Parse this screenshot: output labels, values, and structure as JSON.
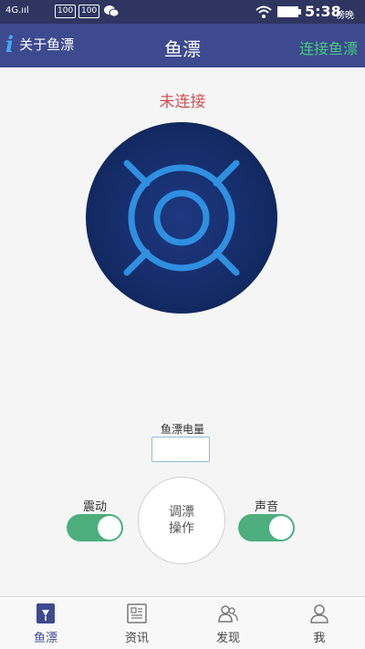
{
  "status_bar": {
    "signal": "4G.ııl",
    "battery_a": "100",
    "battery_b": "100",
    "time": "5:38",
    "period": "傍晚"
  },
  "nav": {
    "about_label": "关于鱼漂",
    "title": "鱼漂",
    "connect_label": "连接鱼漂"
  },
  "main": {
    "connection_status": "未连接",
    "battery_label": "鱼漂电量",
    "battery_value": "",
    "operate_line1": "调漂",
    "operate_line2": "操作",
    "vibration_label": "震动",
    "sound_label": "声音",
    "vibration_on": true,
    "sound_on": true
  },
  "colors": {
    "nav_bg": "#3d4a8f",
    "accent_green": "#45c97c",
    "status_red": "#d05050",
    "toggle_on": "#4caf7d"
  },
  "tabs": [
    {
      "label": "鱼漂",
      "icon": "float-icon",
      "active": true
    },
    {
      "label": "资讯",
      "icon": "news-icon",
      "active": false
    },
    {
      "label": "发现",
      "icon": "discover-icon",
      "active": false
    },
    {
      "label": "我",
      "icon": "profile-icon",
      "active": false
    }
  ]
}
